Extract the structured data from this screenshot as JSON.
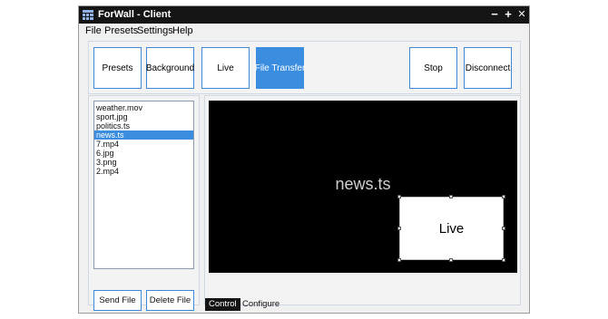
{
  "window": {
    "title": "ForWall - Client",
    "min": "−",
    "max": "+",
    "close": "✕"
  },
  "menu": [
    "File",
    "Presets",
    "Settings",
    "Help"
  ],
  "toolbar": {
    "presets": "Presets",
    "background": "Background",
    "live": "Live",
    "file_transfer": "File Transfer",
    "stop": "Stop",
    "disconnect": "Disconnect"
  },
  "files": [
    "weather.mov",
    "sport.jpg",
    "politics.ts",
    "news.ts",
    "7.mp4",
    "6.jpg",
    "3.png",
    "2.mp4"
  ],
  "selected_file": "news.ts",
  "buttons": {
    "send": "Send File",
    "delete": "Delete File"
  },
  "preview": {
    "label": "news.ts",
    "overlay": "Live"
  },
  "tabs": {
    "control": "Control",
    "configure": "Configure"
  },
  "colors": {
    "accent": "#3b8de0",
    "titlebar": "#151515",
    "preview_bg": "#000000"
  }
}
